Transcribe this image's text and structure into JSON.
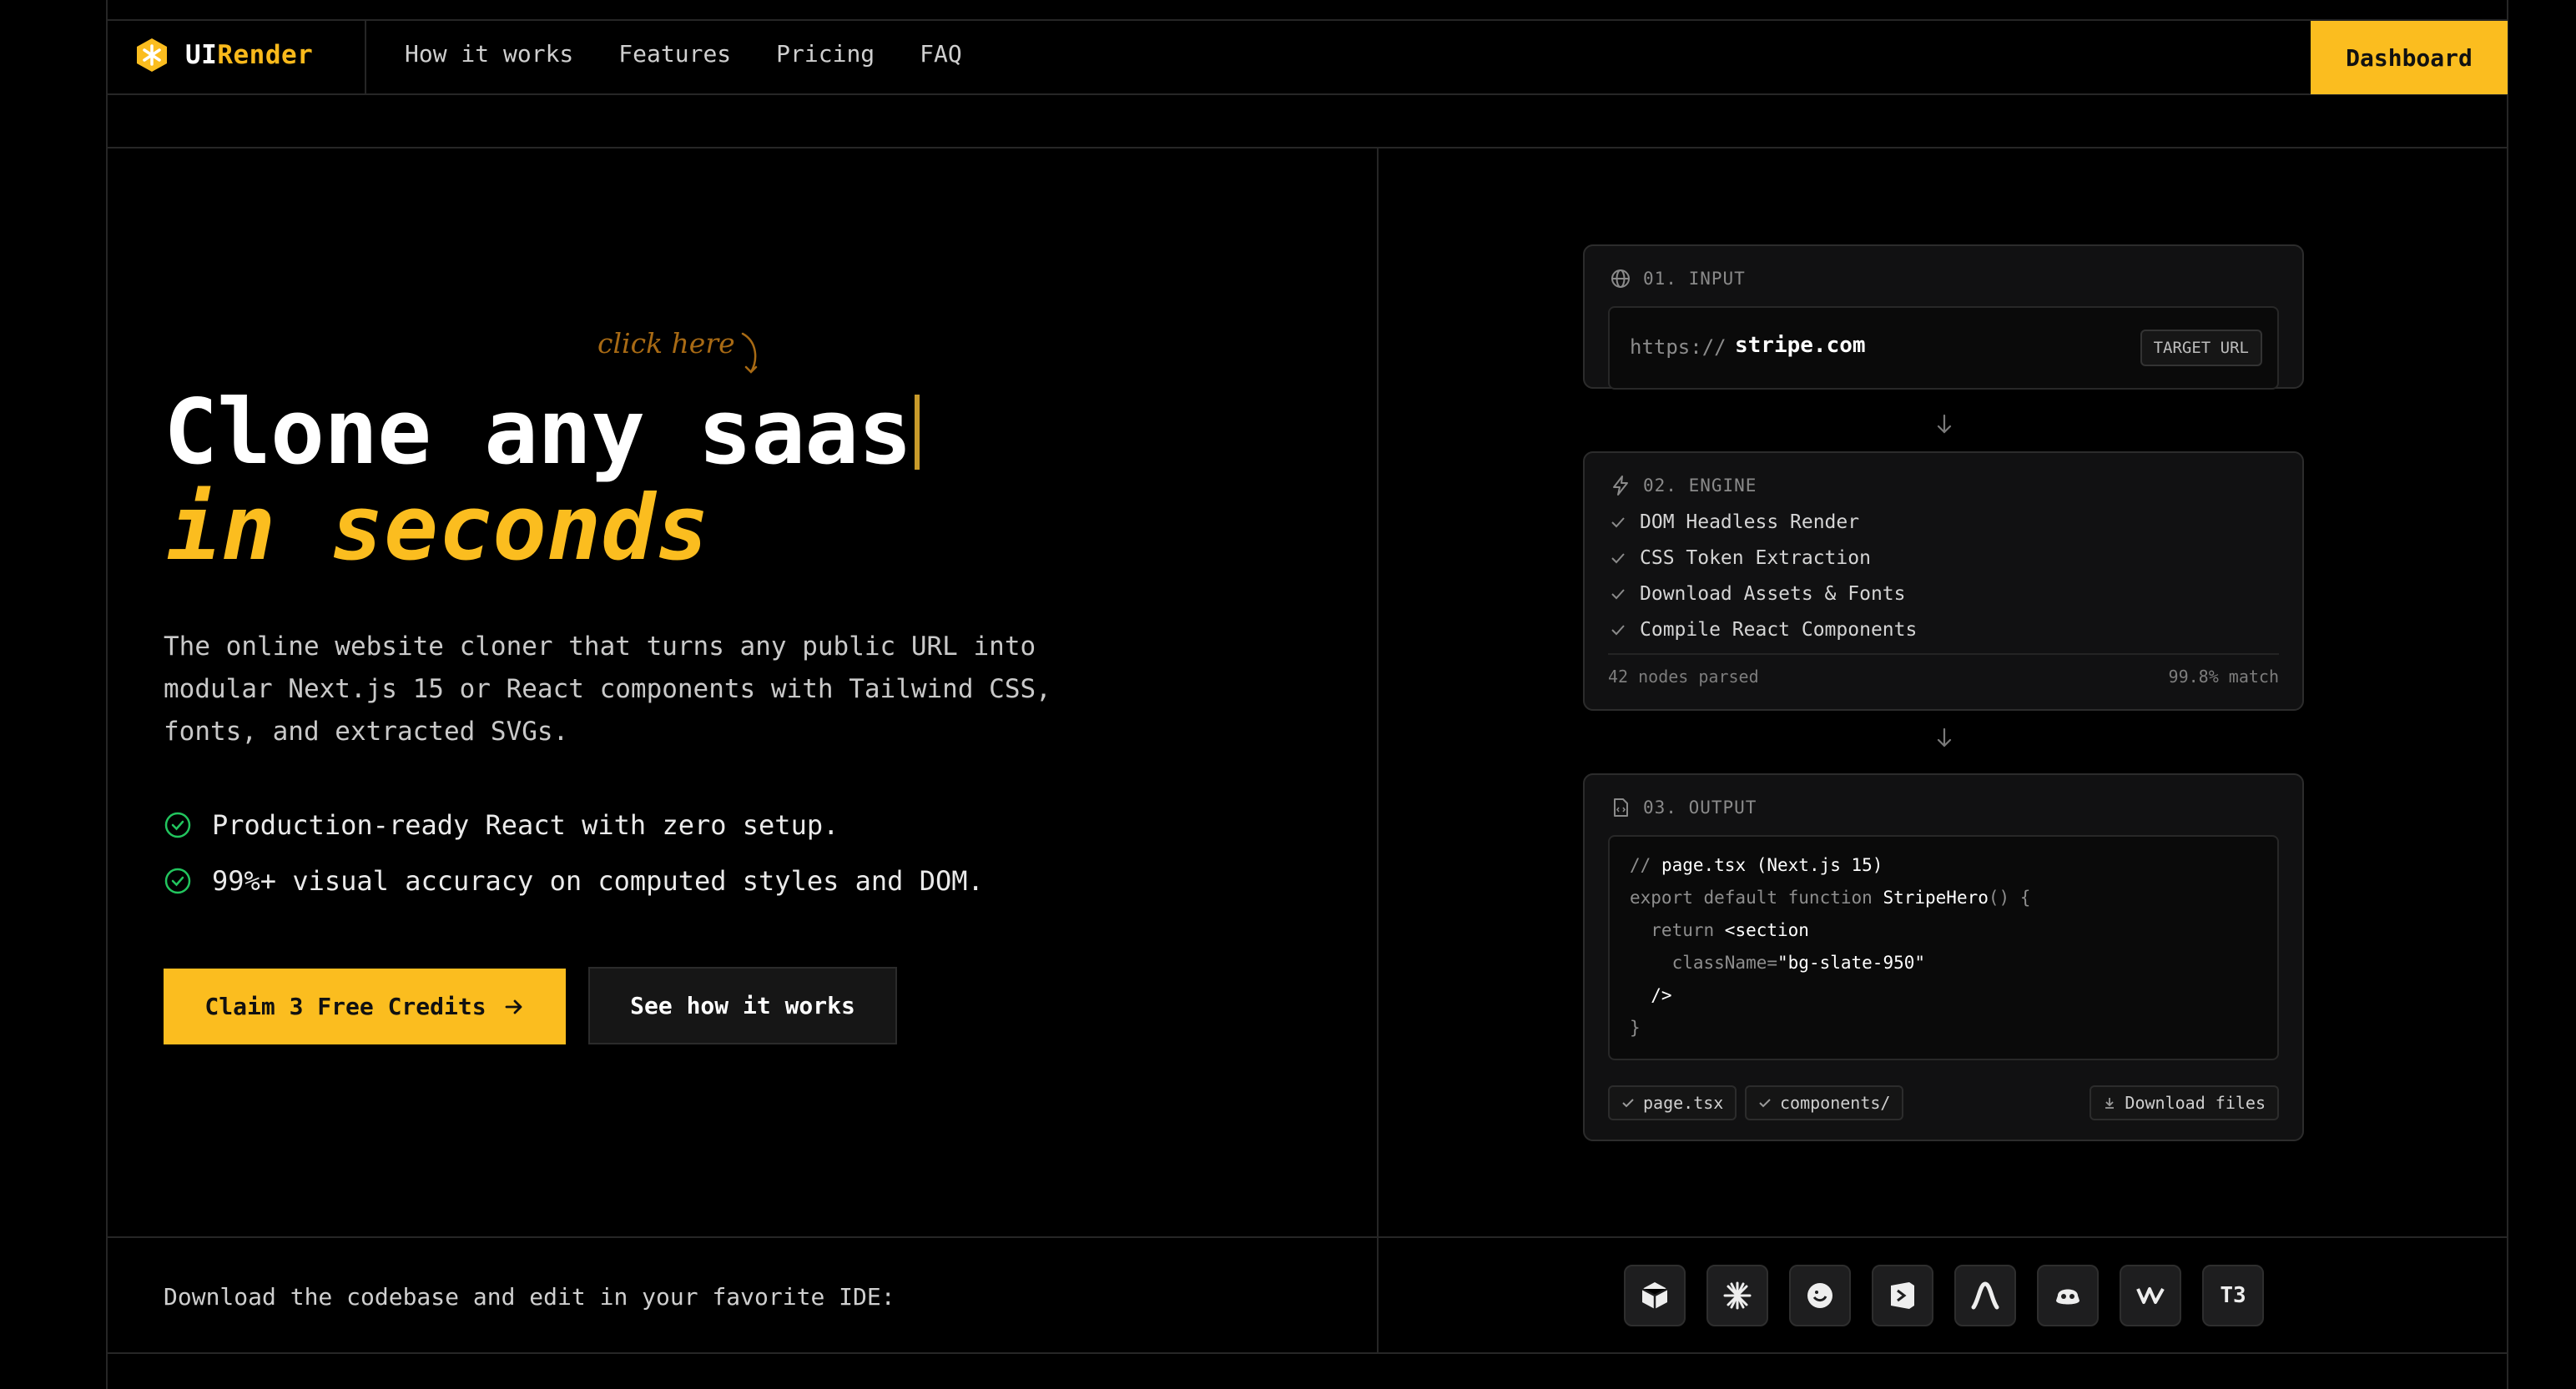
{
  "brand": {
    "name_part1": "UI",
    "name_part2": "Render",
    "accent": "#fbbd1f"
  },
  "nav": {
    "items": [
      "How it works",
      "Features",
      "Pricing",
      "FAQ"
    ],
    "dashboard": "Dashboard"
  },
  "hero": {
    "annotation": "click here",
    "title_line1": "Clone any saas",
    "title_line2": "in seconds",
    "description": "The online website cloner that turns any public URL into modular Next.js 15 or React components with Tailwind CSS, fonts, and extracted SVGs.",
    "features": [
      "Production-ready React with zero setup.",
      "99%+ visual accuracy on computed styles and DOM."
    ],
    "cta_primary": "Claim 3 Free Credits",
    "cta_secondary": "See how it works"
  },
  "pipeline": {
    "input": {
      "header": "01. INPUT",
      "prefix": "https://",
      "value": "stripe.com",
      "tag": "TARGET URL"
    },
    "engine": {
      "header": "02. ENGINE",
      "steps": [
        "DOM Headless Render",
        "CSS Token Extraction",
        "Download Assets & Fonts",
        "Compile React Components"
      ],
      "nodes": "42 nodes parsed",
      "match": "99.8% match"
    },
    "output": {
      "header": "03. OUTPUT",
      "code": {
        "l1a": "// ",
        "l1b": "page.tsx (Next.js 15)",
        "l2a": "export default function ",
        "l2b": "StripeHero",
        "l2c": "() {",
        "l3a": "  return ",
        "l3b": "<section",
        "l4a": "    className=",
        "l4b": "\"bg-slate-950\"",
        "l5": "  />",
        "l6": "}"
      },
      "chip1": "page.tsx",
      "chip2": "components/",
      "download": "Download files"
    }
  },
  "footer": {
    "ide_label": "Download the codebase and edit in your favorite IDE:",
    "ides": [
      "cursor-icon",
      "claude-icon",
      "windsurf-icon",
      "vscode-icon",
      "antigravity-icon",
      "copilot-icon",
      "warp-icon",
      "T3"
    ]
  }
}
